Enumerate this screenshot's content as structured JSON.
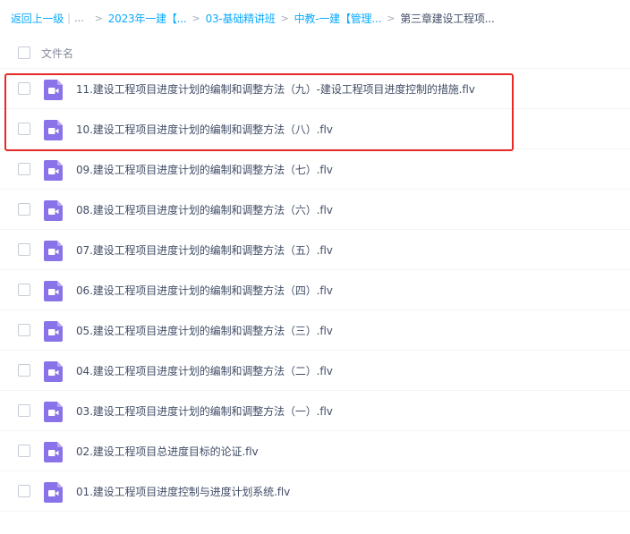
{
  "breadcrumb": {
    "back": "返回上一级",
    "ellipsis": "...",
    "items": [
      "2023年一建【...",
      "03-基础精讲班",
      "中教-一建【管理...",
      "第三章建设工程项..."
    ]
  },
  "header": {
    "column_label": "文件名"
  },
  "files": [
    {
      "name": "11.建设工程项目进度计划的编制和调整方法（九）-建设工程项目进度控制的措施.flv",
      "icon": "video-file-icon"
    },
    {
      "name": "10.建设工程项目进度计划的编制和调整方法（八）.flv",
      "icon": "video-file-icon"
    },
    {
      "name": "09.建设工程项目进度计划的编制和调整方法（七）.flv",
      "icon": "video-file-icon"
    },
    {
      "name": "08.建设工程项目进度计划的编制和调整方法（六）.flv",
      "icon": "video-file-icon"
    },
    {
      "name": "07.建设工程项目进度计划的编制和调整方法（五）.flv",
      "icon": "video-file-icon"
    },
    {
      "name": "06.建设工程项目进度计划的编制和调整方法（四）.flv",
      "icon": "video-file-icon"
    },
    {
      "name": "05.建设工程项目进度计划的编制和调整方法（三）.flv",
      "icon": "video-file-icon"
    },
    {
      "name": "04.建设工程项目进度计划的编制和调整方法（二）.flv",
      "icon": "video-file-icon"
    },
    {
      "name": "03.建设工程项目进度计划的编制和调整方法（一）.flv",
      "icon": "video-file-icon"
    },
    {
      "name": "02.建设工程项目总进度目标的论证.flv",
      "icon": "video-file-icon"
    },
    {
      "name": "01.建设工程项目进度控制与进度计划系统.flv",
      "icon": "video-file-icon"
    }
  ],
  "colors": {
    "link": "#09aaff",
    "text": "#424e67",
    "icon": "#8a73e8",
    "highlight": "#e62a27"
  }
}
